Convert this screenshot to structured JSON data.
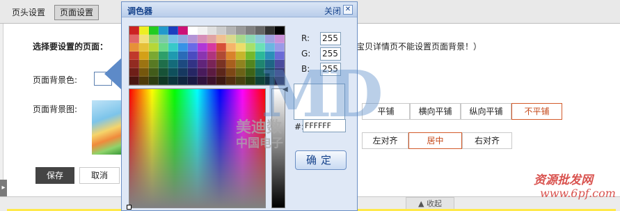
{
  "tabs": {
    "header": "页头设置",
    "page": "页面设置"
  },
  "form": {
    "select_page_label": "选择要设置的页面：",
    "note": "宝贝详情页不能设置页面背景！）",
    "bg_color_label": "页面背景色:",
    "bg_image_label": "页面背景图:",
    "repeat_options": [
      "平铺",
      "横向平铺",
      "纵向平铺",
      "不平铺"
    ],
    "repeat_selected": "不平铺",
    "align_options": [
      "左对齐",
      "居中",
      "右对齐"
    ],
    "align_selected": "居中",
    "save_label": "保存",
    "cancel_label": "取消"
  },
  "bottom": {
    "collapse_label": "▲ 收起",
    "side_handle": "▸"
  },
  "dialog": {
    "title": "调色器",
    "close_label": "关闭",
    "close_glyph": "✕",
    "r_label": "R:",
    "g_label": "G:",
    "b_label": "B:",
    "r": "255",
    "g": "255",
    "b": "255",
    "hex_label": "#:",
    "hex": "FFFFFF",
    "ok_label": "确定",
    "palette": [
      [
        "#cc2222",
        "#eeee22",
        "#22cc22",
        "#2299cc",
        "#1a3fbf",
        "#cc1177",
        "#ffffff",
        "#f2f2f2",
        "#e0e0e0",
        "#cccccc",
        "#b3b3b3",
        "#999999",
        "#808080",
        "#666666",
        "#333333",
        "#000000"
      ],
      [
        "#e06666",
        "#f2e07a",
        "#9ed56b",
        "#7ec9a8",
        "#76c0e6",
        "#8fa9e0",
        "#b394d6",
        "#d68fb8",
        "#e0a3a3",
        "#f0c090",
        "#d9d98c",
        "#a8d98c",
        "#8cd9b3",
        "#8cc9d9",
        "#a0a0e0",
        "#c990d9"
      ],
      [
        "#e69138",
        "#e6c038",
        "#b6d738",
        "#6ad788",
        "#38c9c9",
        "#3892e6",
        "#6a6ae6",
        "#b038d7",
        "#d738a0",
        "#d75038",
        "#f5b46a",
        "#ecdd6a",
        "#a6e06a",
        "#6ae0b6",
        "#6ab6e0",
        "#9a9ae8"
      ],
      [
        "#c0392b",
        "#d4a017",
        "#7aa832",
        "#2e9f6a",
        "#1f9ab0",
        "#2a6bb8",
        "#4b4bc0",
        "#8b34b0",
        "#b0347d",
        "#b04a34",
        "#d9822b",
        "#c6b52b",
        "#73b82b",
        "#2bb89a",
        "#2b8fb8",
        "#6b6bd6"
      ],
      [
        "#922b21",
        "#9c7412",
        "#587a24",
        "#1f6e4a",
        "#146b7a",
        "#1d4a80",
        "#333385",
        "#61247a",
        "#7a2457",
        "#7a3324",
        "#a85f1e",
        "#8f831f",
        "#52851f",
        "#1f8570",
        "#1f6585",
        "#4a4a9c"
      ],
      [
        "#6e1f18",
        "#75570d",
        "#425c1b",
        "#175237",
        "#0f505c",
        "#163860",
        "#262664",
        "#491b5c",
        "#5c1b41",
        "#5c261b",
        "#7d4716",
        "#6b6217",
        "#3d6317",
        "#176354",
        "#174c63",
        "#373775"
      ],
      [
        "#4a1510",
        "#4e3a09",
        "#2c3d12",
        "#0f3725",
        "#0a353d",
        "#0f2540",
        "#191943",
        "#30123d",
        "#3d122b",
        "#3d1912",
        "#532f0f",
        "#47410f",
        "#29420f",
        "#0f4238",
        "#0f3242",
        "#25254e"
      ]
    ]
  },
  "watermark": {
    "logo": "MD",
    "cn_line1": "美迪数",
    "cn_line2": "中国电子",
    "site": "资源批发网",
    "url": "www.6pf.com"
  }
}
